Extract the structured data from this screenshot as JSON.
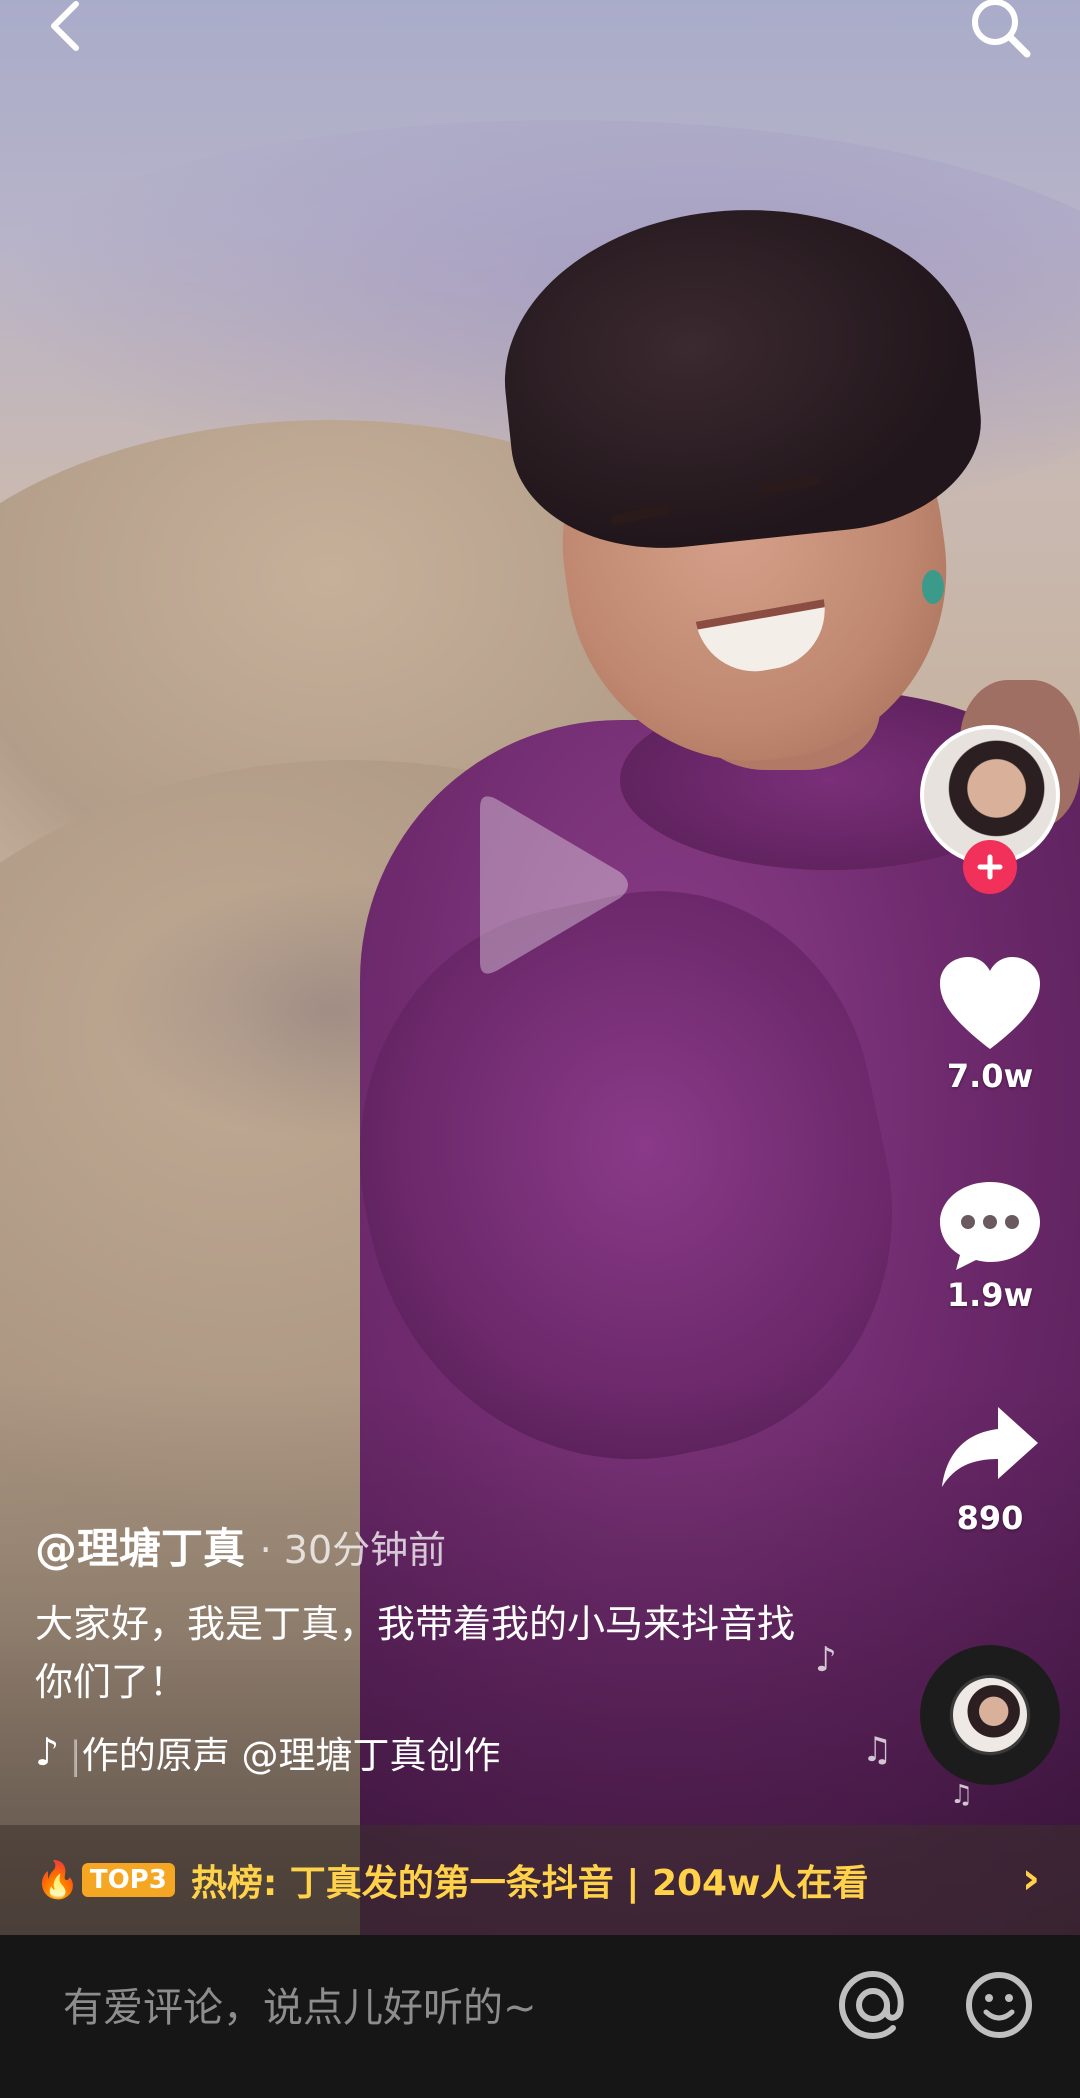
{
  "video": {
    "author": "@理塘丁真",
    "time_ago": "· 30分钟前",
    "description": "大家好，我是丁真，我带着我的小马来抖音找你们了！",
    "music_text": "|作的原声    @理塘丁真创作"
  },
  "stats": {
    "likes": "7.0w",
    "comments": "1.9w",
    "shares": "890"
  },
  "hot": {
    "badge": "TOP3",
    "text": "热榜: 丁真发的第一条抖音 | 204w人在看"
  },
  "comment": {
    "placeholder": "有爱评论，说点儿好听的~"
  },
  "icons": {
    "back": "chevron-left-icon",
    "search": "search-icon",
    "play": "play-icon",
    "like": "heart-icon",
    "comment": "comment-bubble-icon",
    "share": "share-arrow-icon",
    "at": "at-icon",
    "emoji": "smile-icon"
  },
  "colors": {
    "accent_red": "#f2315a",
    "hot_yellow": "#ffd24a",
    "badge_orange": "#f5a623"
  }
}
